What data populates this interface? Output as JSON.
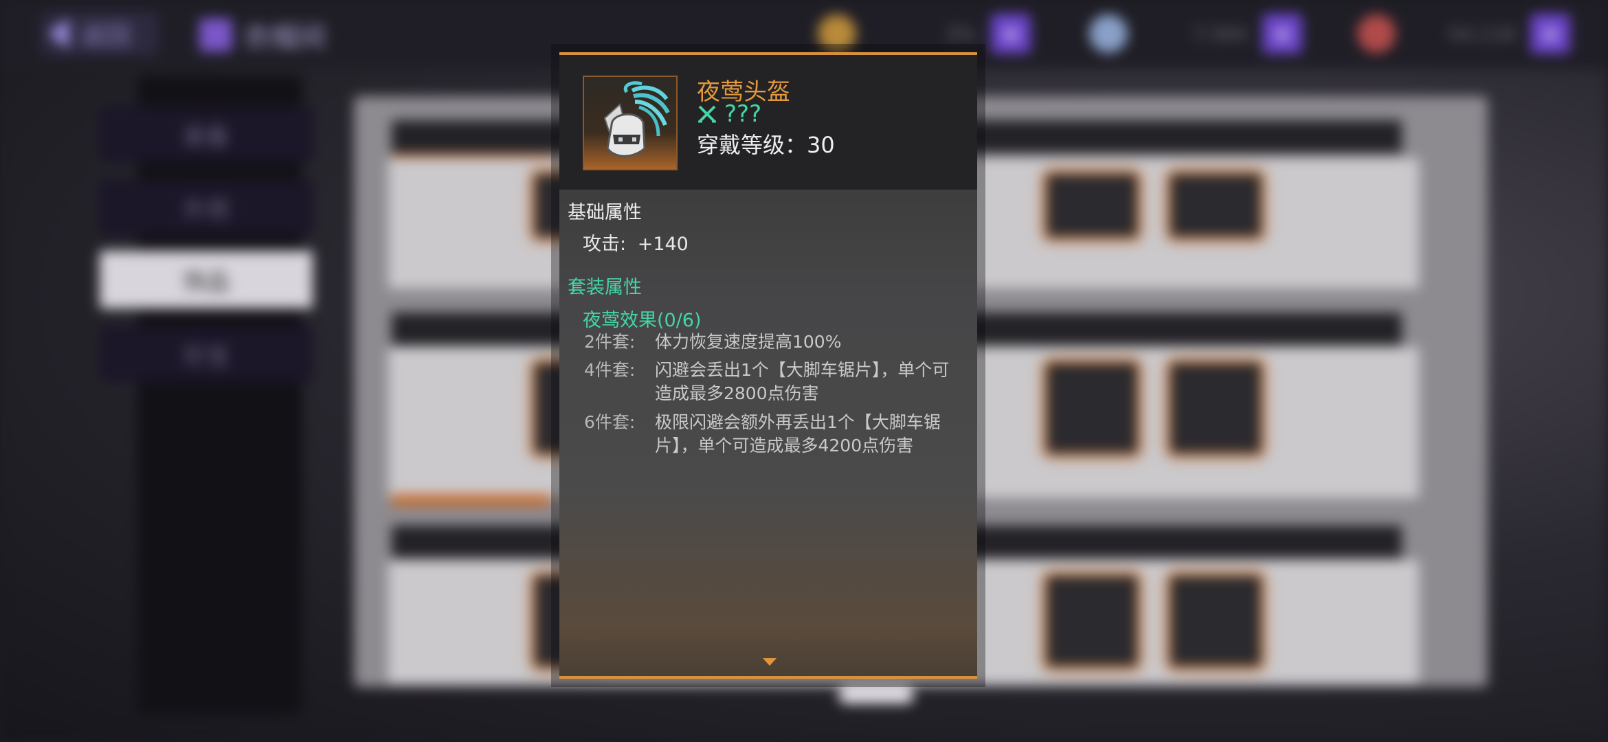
{
  "topbar": {
    "back_label": "返回",
    "title": "衣帽间",
    "resources": [
      {
        "name": "gold-coin",
        "value": "3%"
      },
      {
        "name": "crystal",
        "value": "7,564"
      },
      {
        "name": "energy",
        "value": "54,118"
      }
    ]
  },
  "sidebar": {
    "items": [
      {
        "label": "装备"
      },
      {
        "label": "外观"
      },
      {
        "label": "饰品"
      },
      {
        "label": "珍宝"
      }
    ]
  },
  "tooltip": {
    "item_name": "夜莺头盔",
    "item_tag": "???",
    "level_text": "穿戴等级：30",
    "base_title": "基础属性",
    "base_stats": [
      {
        "label": "攻击:",
        "value": "+140"
      }
    ],
    "set_title": "套装属性",
    "set_name": "夜莺效果(0/6)",
    "set_effects": [
      {
        "key": "2件套:",
        "text": "体力恢复速度提高100%"
      },
      {
        "key": "4件套:",
        "text": "闪避会丢出1个【大脚车锯片】，单个可造成最多2800点伤害"
      },
      {
        "key": "6件套:",
        "text": "极限闪避会额外再丢出1个【大脚车锯片】，单个可造成最多4200点伤害"
      }
    ]
  },
  "colors": {
    "accent_orange": "#d7913e",
    "set_green": "#44d6a4",
    "item_name": "#e49a3d"
  }
}
